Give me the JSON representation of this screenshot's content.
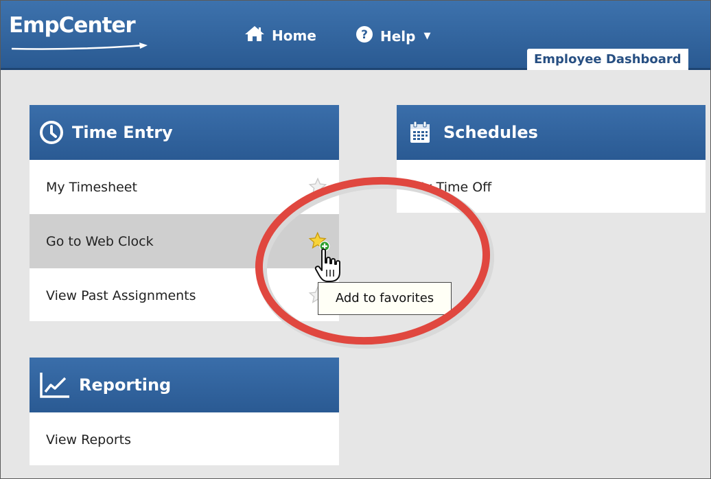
{
  "header": {
    "logo": "EmpCenter",
    "nav": {
      "home_label": "Home",
      "help_label": "Help"
    },
    "active_tab": "Employee Dashboard"
  },
  "time_entry": {
    "title": "Time Entry",
    "items": [
      {
        "label": "My Timesheet"
      },
      {
        "label": "Go to Web Clock"
      },
      {
        "label": "View Past Assignments"
      }
    ]
  },
  "schedules": {
    "title": "Schedules",
    "items": [
      {
        "label": "My Time Off"
      }
    ]
  },
  "reporting": {
    "title": "Reporting",
    "items": [
      {
        "label": "View Reports"
      }
    ]
  },
  "tooltip": {
    "text": "Add to favorites"
  },
  "colors": {
    "header_blue": "#2f609a",
    "highlight_ring": "#e0473f",
    "row_hover": "#cfcfcf"
  }
}
